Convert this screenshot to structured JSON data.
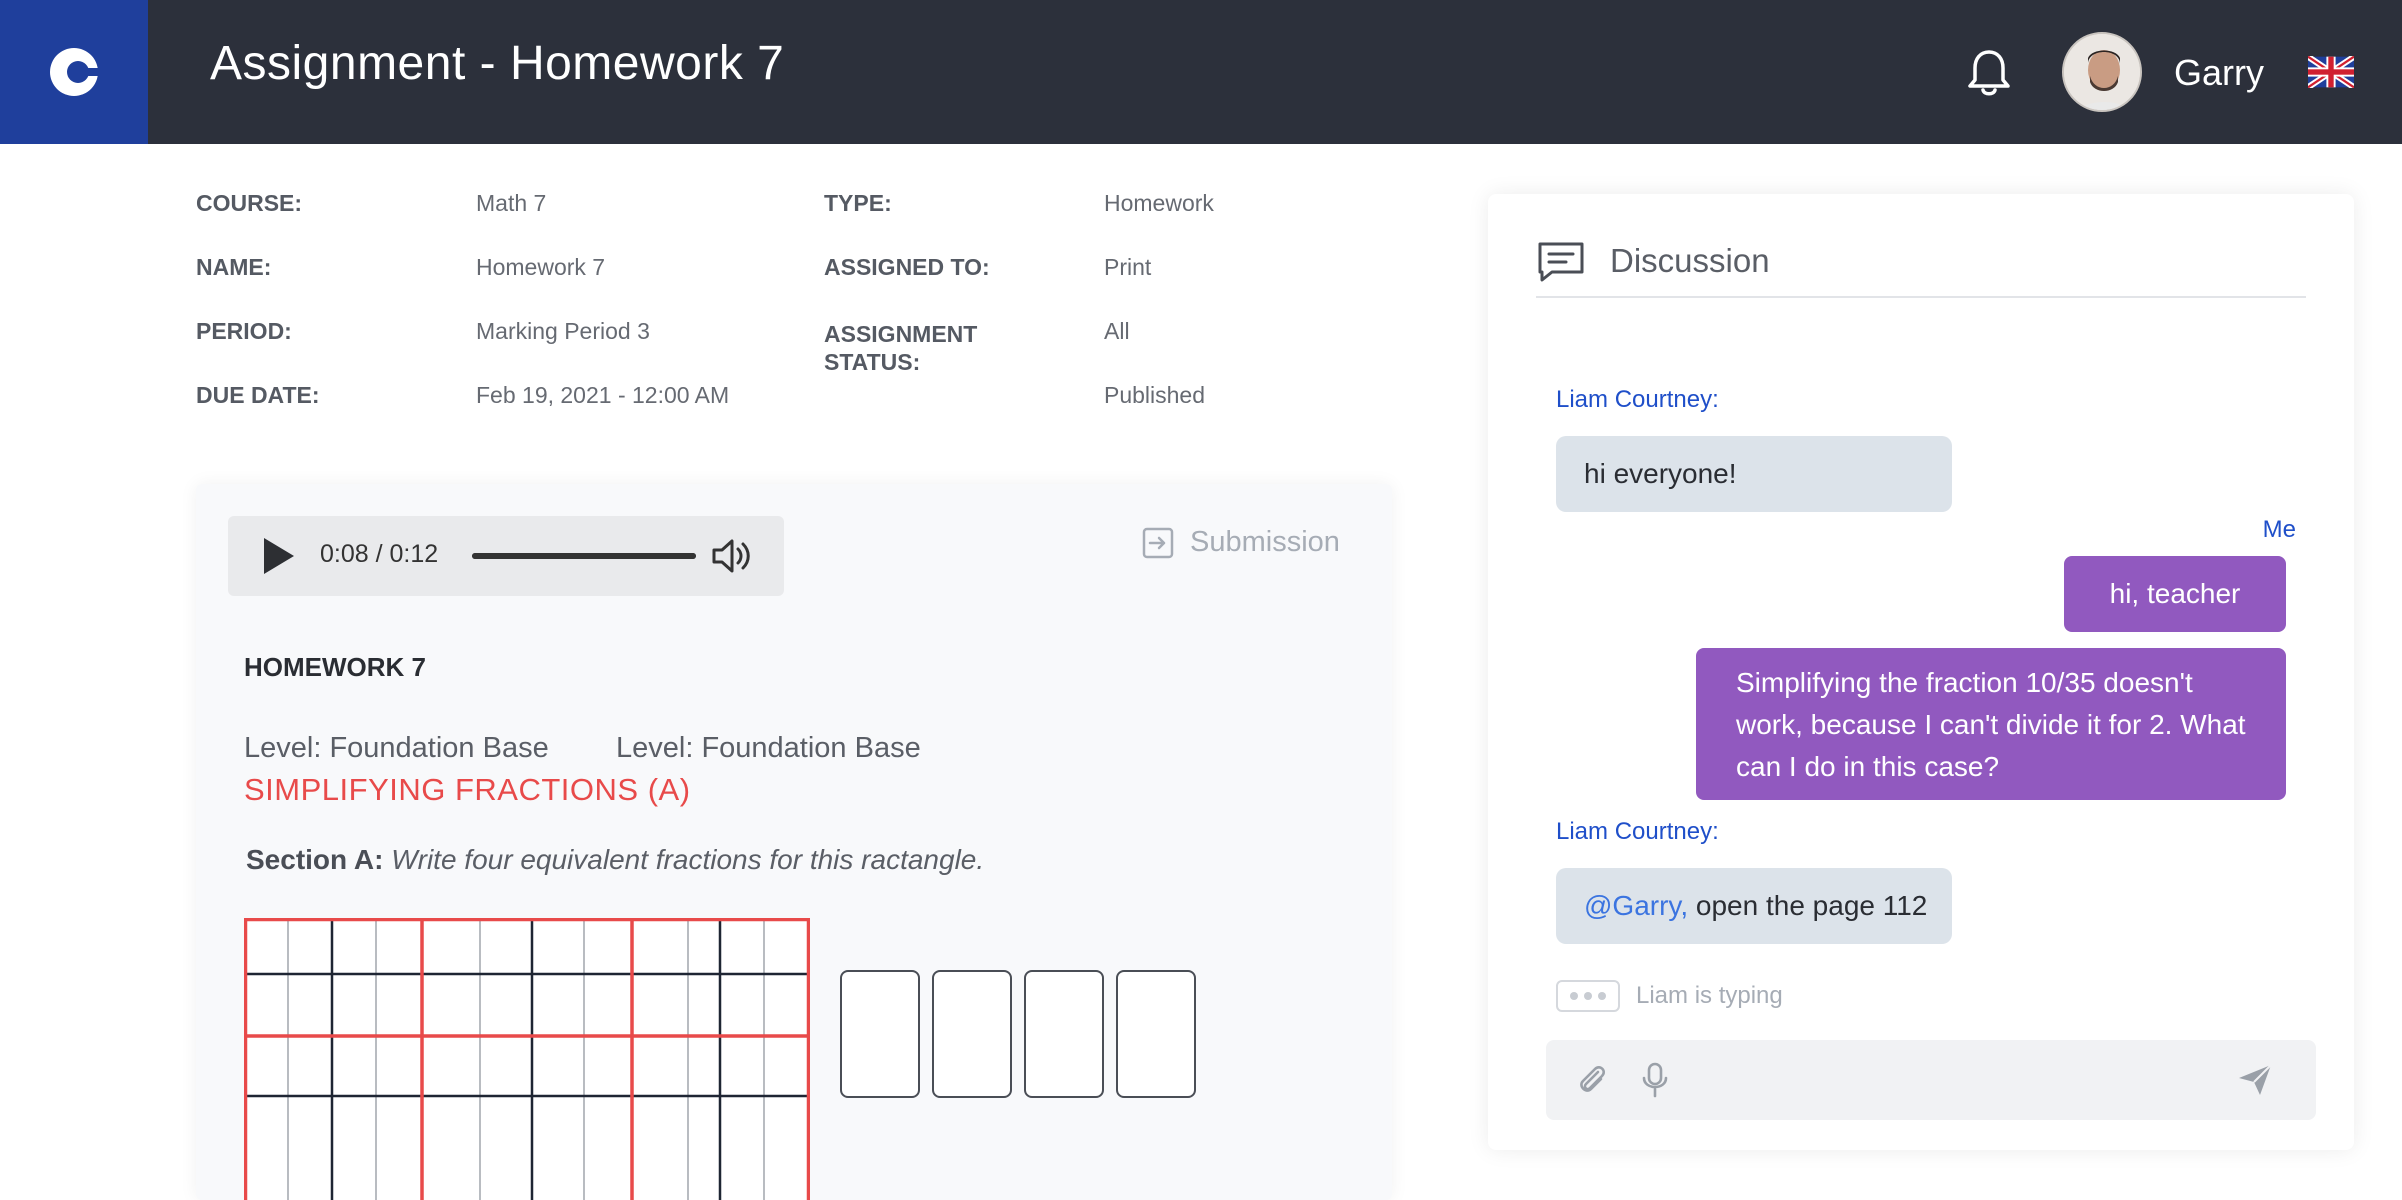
{
  "header": {
    "title": "Assignment - Homework 7",
    "user_name": "Garry",
    "icons": [
      "logo-icon",
      "bell-icon",
      "avatar",
      "uk-flag-icon"
    ],
    "colors": {
      "topbar": "#2c303b",
      "logo_bg": "#1f3f9c"
    }
  },
  "info": {
    "left": [
      {
        "label": "COURSE:",
        "value": "Math 7"
      },
      {
        "label": "NAME:",
        "value": "Homework 7"
      },
      {
        "label": "PERIOD:",
        "value": "Marking Period 3"
      },
      {
        "label": "DUE DATE:",
        "value": "Feb 19,  2021 - 12:00 AM"
      }
    ],
    "right": [
      {
        "label": "TYPE:",
        "value": "Homework"
      },
      {
        "label": "ASSIGNED TO:",
        "value": "Print"
      },
      {
        "label": "ASSIGNMENT STATUS:",
        "value": "All"
      },
      {
        "label": "",
        "value": "Published"
      }
    ]
  },
  "card": {
    "audio": {
      "time": "0:08 / 0:12",
      "progress": 1.0
    },
    "submission_label": "Submission",
    "homework_title": "HOMEWORK 7",
    "levels": [
      "Level: Foundation Base",
      "Level: Foundation Base"
    ],
    "topic": "SIMPLIFYING FRACTIONS (A)",
    "section_label": "Section A:",
    "section_text": "Write four equivalent fractions for this ractangle.",
    "answer_boxes": 4,
    "colors": {
      "topic": "#e84a4a",
      "grid_major": "#e84a4a",
      "grid_minor": "#1e2533"
    }
  },
  "discussion": {
    "title": "Discussion",
    "messages": [
      {
        "sender": "Liam Courtney:",
        "text": "hi everyone!",
        "own": false
      },
      {
        "sender": "Me",
        "text": "hi, teacher",
        "own": true
      },
      {
        "sender": "",
        "text": "Simplifying the fraction 10/35 doesn't work, because I can't divide it for 2. What can I do in this case?",
        "own": true
      },
      {
        "sender": "Liam Courtney:",
        "mention": "@Garry,",
        "text": " open the page 112",
        "own": false
      }
    ],
    "typing": "Liam is typing",
    "composer_placeholder": "",
    "colors": {
      "own_bubble": "#9159bf",
      "other_bubble": "#dce3ea",
      "sender": "#1f4fc9"
    }
  }
}
